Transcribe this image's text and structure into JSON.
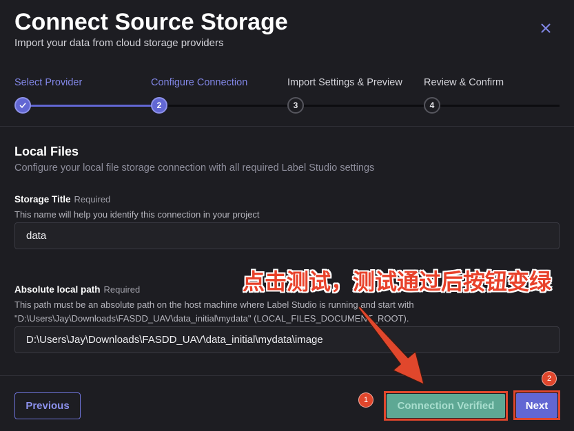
{
  "dialog": {
    "title": "Connect Source Storage",
    "subtitle": "Import your data from cloud storage providers",
    "close_icon": "close-icon"
  },
  "stepper": {
    "current_step": 2,
    "steps": [
      {
        "label": "Select Provider",
        "icon": "check-icon"
      },
      {
        "label": "Configure Connection",
        "marker": "2"
      },
      {
        "label": "Import Settings & Preview",
        "marker": "3"
      },
      {
        "label": "Review & Confirm",
        "marker": "4"
      }
    ]
  },
  "section": {
    "title": "Local Files",
    "description": "Configure your local file storage connection with all required Label Studio settings"
  },
  "fields": {
    "storage_title": {
      "label": "Storage Title",
      "required_tag": "Required",
      "help": "This name will help you identify this connection in your project",
      "value": "data"
    },
    "local_path": {
      "label": "Absolute local path",
      "required_tag": "Required",
      "help_lines": [
        "This path must be an absolute path on the host machine where Label Studio is running and start with",
        "\"D:\\Users\\Jay\\Downloads\\FASDD_UAV\\data_initial\\mydata\" (LOCAL_FILES_DOCUMENT_ROOT)."
      ],
      "value": "D:\\Users\\Jay\\Downloads\\FASDD_UAV\\data_initial\\mydata\\image"
    }
  },
  "footer": {
    "previous_label": "Previous",
    "verify_label": "Connection Verified",
    "next_label": "Next"
  },
  "annotations": {
    "callout_text": "点击测试，测试通过后按钮变绿",
    "marker_1": "1",
    "marker_2": "2"
  },
  "colors": {
    "background": "#1d1d22",
    "accent": "#6267d3",
    "accent_text": "#8186e6",
    "verified": "#5ea894",
    "annotation": "#e0462c"
  }
}
